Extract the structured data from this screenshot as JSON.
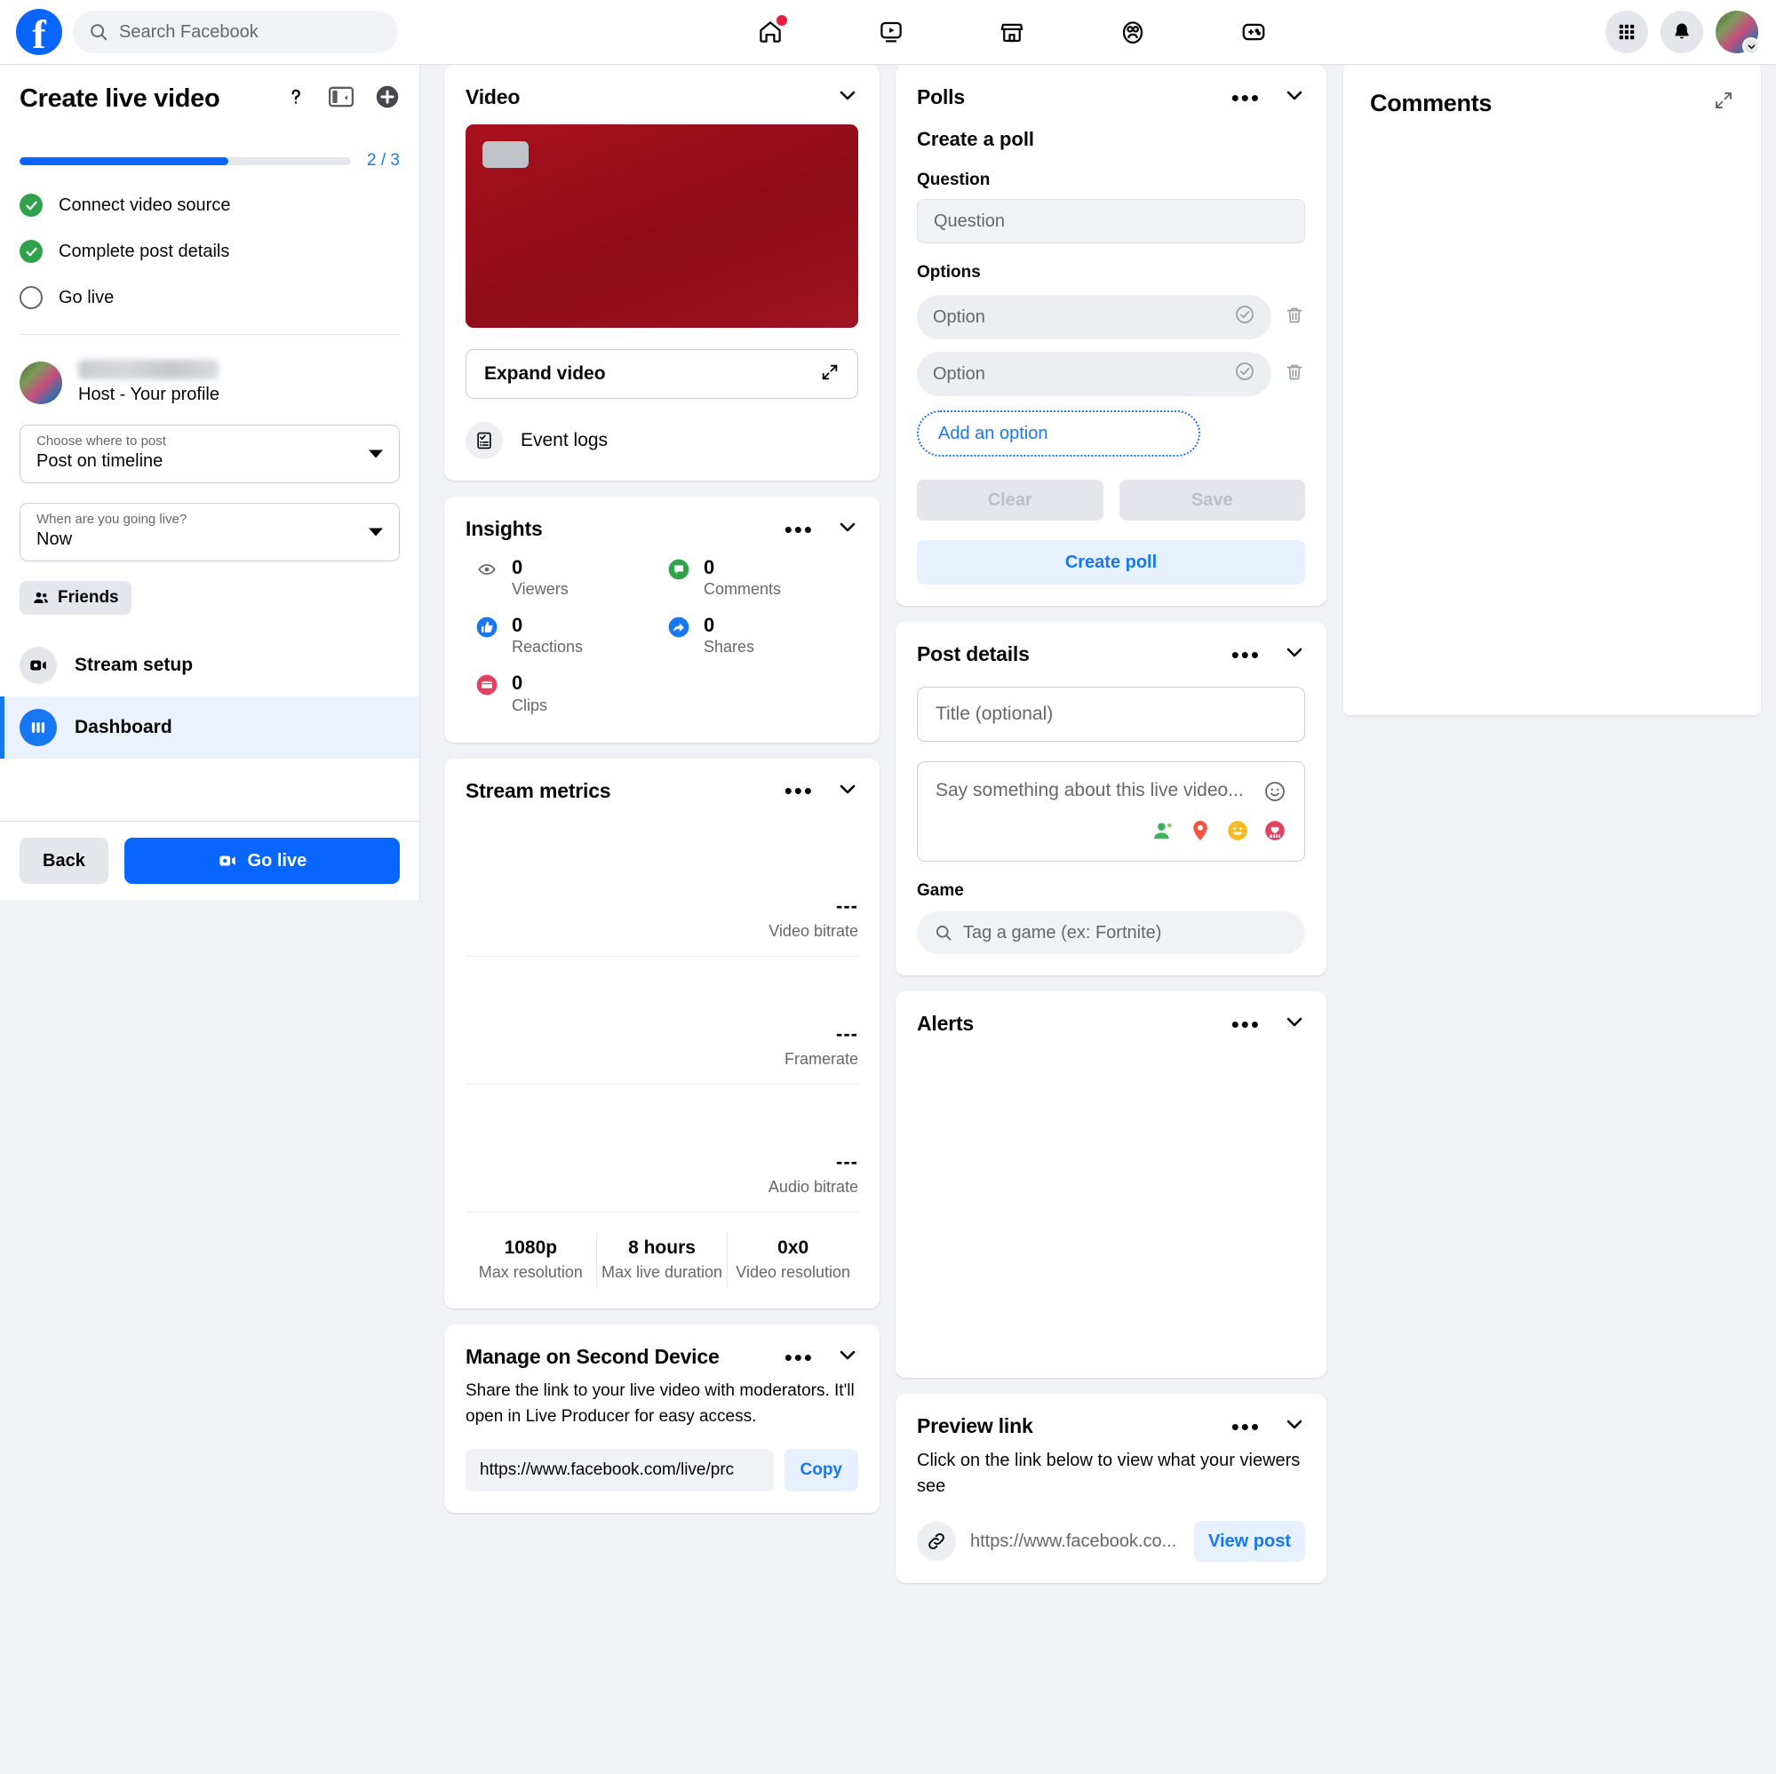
{
  "topnav": {
    "search_placeholder": "Search Facebook",
    "icons": [
      {
        "name": "home-icon",
        "badge": true
      },
      {
        "name": "watch-video-icon",
        "badge": false
      },
      {
        "name": "marketplace-icon",
        "badge": false
      },
      {
        "name": "groups-icon",
        "badge": false
      },
      {
        "name": "gaming-icon",
        "badge": false
      }
    ],
    "menu_icon": "grid-menu-icon",
    "notifications_icon": "bell-icon",
    "account_icon": "avatar"
  },
  "sidebar": {
    "title": "Create live video",
    "help_icon": "question-mark-icon",
    "layout_icon": "panel-layout-icon",
    "add_icon": "plus-circle-icon",
    "progress": {
      "label": "2 / 3",
      "percent": 63
    },
    "steps": [
      {
        "label": "Connect video source",
        "state": "complete"
      },
      {
        "label": "Complete post details",
        "state": "complete"
      },
      {
        "label": "Go live",
        "state": "pending"
      }
    ],
    "host": {
      "name": "",
      "role": "Host - Your profile"
    },
    "where_to_post": {
      "label": "Choose where to post",
      "value": "Post on timeline"
    },
    "when_going_live": {
      "label": "When are you going live?",
      "value": "Now"
    },
    "audience": {
      "label": "Friends",
      "icon": "friends-icon"
    },
    "nav": [
      {
        "label": "Stream setup",
        "icon": "video-camera-icon",
        "active": false
      },
      {
        "label": "Dashboard",
        "icon": "dashboard-columns-icon",
        "active": true
      }
    ],
    "back_label": "Back",
    "go_live_label": "Go live"
  },
  "video_card": {
    "title": "Video",
    "expand_label": "Expand video",
    "expand_icon": "expand-arrows-icon",
    "event_logs_label": "Event logs",
    "event_logs_icon": "checklist-icon",
    "preview_color": "#9e0f1a"
  },
  "insights": {
    "title": "Insights",
    "stats": [
      {
        "label": "Viewers",
        "value": "0",
        "icon": "eye-icon",
        "color": "#65676b"
      },
      {
        "label": "Comments",
        "value": "0",
        "icon": "comment-bubble-icon",
        "color": "#31a24c"
      },
      {
        "label": "Reactions",
        "value": "0",
        "icon": "thumbs-up-icon",
        "color": "#1877f2"
      },
      {
        "label": "Shares",
        "value": "0",
        "icon": "share-arrow-icon",
        "color": "#1877f2"
      },
      {
        "label": "Clips",
        "value": "0",
        "icon": "clips-icon",
        "color": "#e4405f"
      }
    ]
  },
  "stream_metrics": {
    "title": "Stream metrics",
    "metrics": [
      {
        "label": "Video bitrate",
        "value": "---"
      },
      {
        "label": "Framerate",
        "value": "---"
      },
      {
        "label": "Audio bitrate",
        "value": "---"
      }
    ],
    "stats": [
      {
        "value": "1080p",
        "label": "Max resolution"
      },
      {
        "value": "8 hours",
        "label": "Max live duration"
      },
      {
        "value": "0x0",
        "label": "Video resolution"
      }
    ]
  },
  "manage_second_device": {
    "title": "Manage on Second Device",
    "description": "Share the link to your live video with moderators. It'll open in Live Producer for easy access.",
    "url": "https://www.facebook.com/live/prc",
    "copy_label": "Copy"
  },
  "polls": {
    "title": "Polls",
    "subtitle": "Create a poll",
    "question_label": "Question",
    "question_placeholder": "Question",
    "options_label": "Options",
    "options": [
      {
        "placeholder": "Option"
      },
      {
        "placeholder": "Option"
      }
    ],
    "add_option_label": "Add an option",
    "clear_label": "Clear",
    "save_label": "Save",
    "create_label": "Create poll",
    "check_icon": "check-circle-icon",
    "delete_icon": "trash-icon"
  },
  "post_details": {
    "title": "Post details",
    "title_placeholder": "Title (optional)",
    "composer_placeholder": "Say something about this live video...",
    "emoji_icon": "smiley-icon",
    "composer_icons": [
      {
        "name": "tag-people-icon",
        "color": "#41b35d"
      },
      {
        "name": "location-pin-icon",
        "color": "#f5533d"
      },
      {
        "name": "feeling-icon",
        "color": "#f7b928"
      },
      {
        "name": "life-event-icon",
        "color": "#e4405f"
      }
    ],
    "game_label": "Game",
    "game_placeholder": "Tag a game (ex: Fortnite)",
    "game_search_icon": "search-icon"
  },
  "alerts": {
    "title": "Alerts"
  },
  "preview_link": {
    "title": "Preview link",
    "description": "Click on the link below to view what your viewers see",
    "link_icon": "chain-link-icon",
    "url": "https://www.facebook.co...",
    "button_label": "View post"
  },
  "comments": {
    "title": "Comments",
    "collapse_icon": "collapse-arrows-icon"
  }
}
